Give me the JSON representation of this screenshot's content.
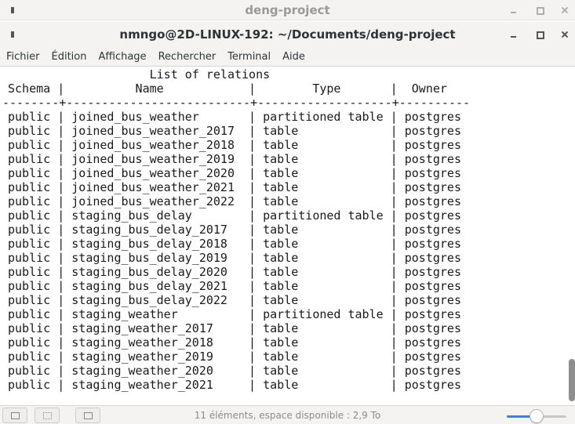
{
  "background_window": {
    "title": "deng-project",
    "status_text": "11 éléments, espace disponible : 2,9 To",
    "zoom_level": 0.5
  },
  "terminal_window": {
    "title": "nmngo@2D-LINUX-192: ~/Documents/deng-project"
  },
  "menu": [
    "Fichier",
    "Édition",
    "Affichage",
    "Rechercher",
    "Terminal",
    "Aide"
  ],
  "terminal_lines": [
    "                    List of relations",
    "Schema |          Name            |        Type       |  Owner",
    "--------+--------------------------+-------------------+----------",
    "public | joined_bus_weather       | partitioned table | postgres",
    "public | joined_bus_weather_2017  | table             | postgres",
    "public | joined_bus_weather_2018  | table             | postgres",
    "public | joined_bus_weather_2019  | table             | postgres",
    "public | joined_bus_weather_2020  | table             | postgres",
    "public | joined_bus_weather_2021  | table             | postgres",
    "public | joined_bus_weather_2022  | table             | postgres",
    "public | staging_bus_delay        | partitioned table | postgres",
    "public | staging_bus_delay_2017   | table             | postgres",
    "public | staging_bus_delay_2018   | table             | postgres",
    "public | staging_bus_delay_2019   | table             | postgres",
    "public | staging_bus_delay_2020   | table             | postgres",
    "public | staging_bus_delay_2021   | table             | postgres",
    "public | staging_bus_delay_2022   | table             | postgres",
    "public | staging_weather          | partitioned table | postgres",
    "public | staging_weather_2017     | table             | postgres",
    "public | staging_weather_2018     | table             | postgres",
    "public | staging_weather_2019     | table             | postgres",
    "public | staging_weather_2020     | table             | postgres",
    "public | staging_weather_2021     | table             | postgres"
  ]
}
